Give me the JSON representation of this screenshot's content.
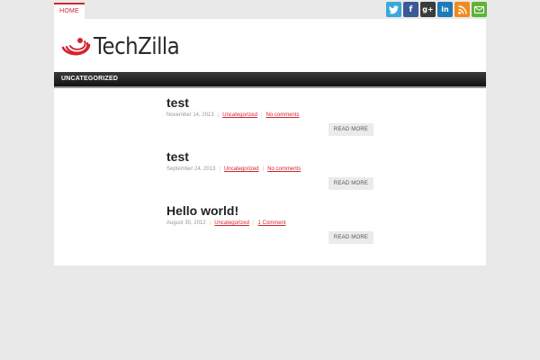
{
  "nav": {
    "home_label": "HOME"
  },
  "social": [
    {
      "name": "twitter",
      "icon": "twitter-icon",
      "color": "#3aa8dc"
    },
    {
      "name": "facebook",
      "icon": "facebook-icon",
      "color": "#3b5998",
      "glyph": "f"
    },
    {
      "name": "googleplus",
      "icon": "googleplus-icon",
      "color": "#3b3b3b",
      "glyph": "g+"
    },
    {
      "name": "linkedin",
      "icon": "linkedin-icon",
      "color": "#1f7ab8",
      "glyph": "in"
    },
    {
      "name": "rss",
      "icon": "rss-icon",
      "color": "#f18a1e"
    },
    {
      "name": "email",
      "icon": "email-icon",
      "color": "#5fb336"
    }
  ],
  "logo": {
    "text": "TechZilla",
    "accent_color": "#d3242f"
  },
  "category_bar": {
    "label": "UNCATEGORIZED"
  },
  "posts": [
    {
      "title": "test",
      "date": "November 14, 2013",
      "category": "Uncategorized",
      "comments": "No comments",
      "read_more": "READ MORE"
    },
    {
      "title": "test",
      "date": "September 24, 2013",
      "category": "Uncategorized",
      "comments": "No comments",
      "read_more": "READ MORE"
    },
    {
      "title": "Hello world!",
      "date": "August 30, 2012",
      "category": "Uncategorized",
      "comments": "1 Comment",
      "read_more": "READ MORE"
    }
  ]
}
